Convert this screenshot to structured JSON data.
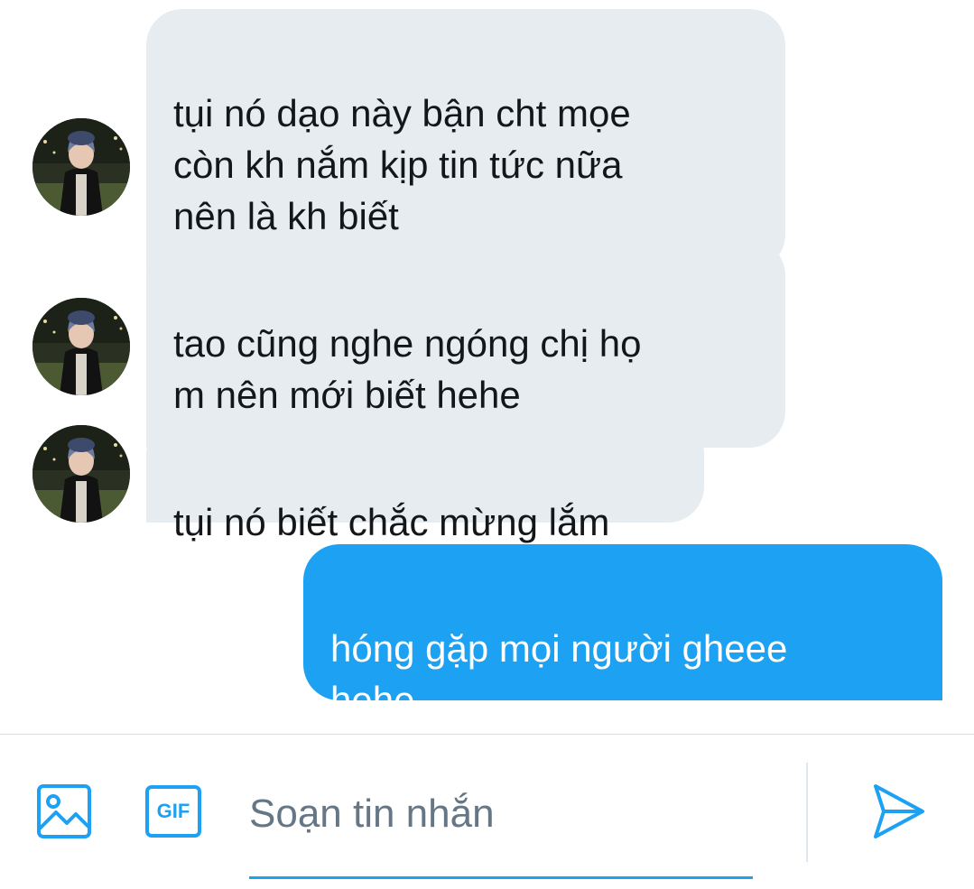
{
  "messages": [
    {
      "direction": "incoming",
      "text": "tụi nó dạo này bận cht mọe\ncòn kh nắm kịp tin tức nữa\nnên là kh biết",
      "has_avatar": true
    },
    {
      "direction": "incoming",
      "text": "tao cũng nghe ngóng chị họ\nm nên mới biết hehe",
      "has_avatar": true
    },
    {
      "direction": "incoming",
      "text": "tụi nó biết chắc mừng lắm",
      "has_avatar": true
    },
    {
      "direction": "outgoing",
      "text": "hóng gặp mọi người gheee\nhehe",
      "has_avatar": false
    }
  ],
  "composer": {
    "image_button_icon": "image-icon",
    "gif_button_label": "GIF",
    "input_placeholder": "Soạn tin nhắn",
    "input_value": "",
    "send_button_icon": "send-icon"
  },
  "colors": {
    "accent": "#1da1f2",
    "incoming_bubble": "#e6ecf0",
    "outgoing_bubble": "#1da1f2",
    "placeholder_text": "#657786"
  }
}
